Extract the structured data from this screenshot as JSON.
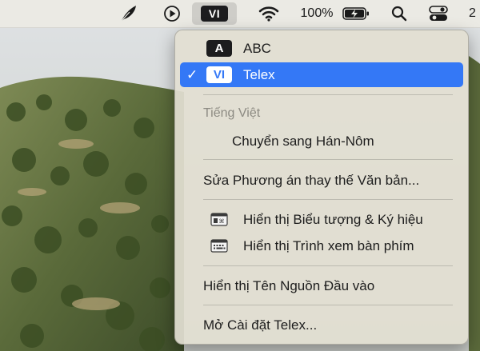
{
  "menubar": {
    "battery_percent": "100%",
    "clock_partial": "2",
    "input_badge": "VI",
    "icons": [
      "feather-icon",
      "play-circle-icon",
      "wifi-icon",
      "battery-charging-icon",
      "search-icon",
      "control-center-icon"
    ]
  },
  "menu": {
    "input_sources": [
      {
        "badge": "A",
        "label": "ABC",
        "selected": false
      },
      {
        "badge": "VI",
        "label": "Telex",
        "selected": true
      }
    ],
    "check_mark": "✓",
    "section_header": "Tiếng Việt",
    "convert_item": "Chuyển sang Hán-Nôm",
    "edit_substitutions": "Sửa Phương án thay thế Văn bản...",
    "show_emoji_symbols": "Hiển thị Biểu tượng & Ký hiệu",
    "show_keyboard_viewer": "Hiển thị Trình xem bàn phím",
    "show_input_source_name": "Hiển thị Tên Nguồn Đầu vào",
    "open_telex_settings": "Mở Cài đặt Telex..."
  },
  "colors": {
    "selection": "#3478f6",
    "menu_background": "#e2dfd2"
  }
}
